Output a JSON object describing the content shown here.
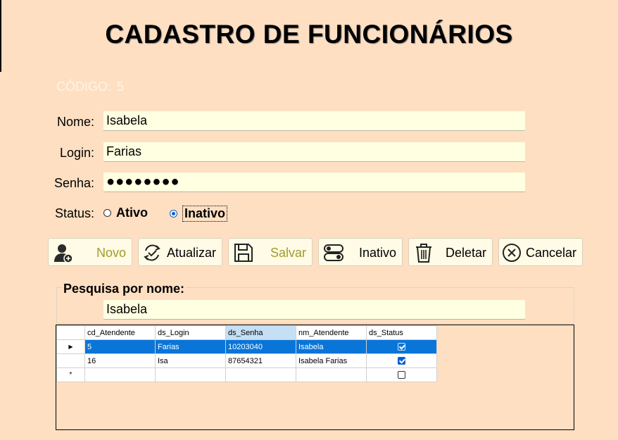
{
  "form": {
    "title": "CADASTRO DE FUNCIONÁRIOS",
    "codigo_label": "CÓDIGO:",
    "codigo_value": "5",
    "nome_label": "Nome:",
    "nome_value": "Isabela",
    "login_label": "Login:",
    "login_value": "Farias",
    "senha_label": "Senha:",
    "senha_value": "●●●●●●●●",
    "status_label": "Status:",
    "status_options": [
      "Ativo",
      "Inativo"
    ],
    "status_selected": "Inativo"
  },
  "toolbar": {
    "novo": "Novo",
    "atualizar": "Atualizar",
    "salvar": "Salvar",
    "inativo": "Inativo",
    "deletar": "Deletar",
    "cancelar": "Cancelar"
  },
  "search": {
    "label": "Pesquisa por nome:",
    "value": "Isabela"
  },
  "grid": {
    "columns": [
      "cd_Atendente",
      "ds_Login",
      "ds_Senha",
      "nm_Atendente",
      "ds_Status"
    ],
    "rows": [
      {
        "cd": "5",
        "login": "Farias",
        "senha": "10203040",
        "nome": "Isabela",
        "status": true
      },
      {
        "cd": "16",
        "login": "Isa",
        "senha": "87654321",
        "nome": "Isabela Farias",
        "status": true
      }
    ],
    "row_indicator": "▶",
    "new_row_indicator": "*"
  },
  "colors": {
    "background": "#ffdfc2",
    "field": "#ffffe1",
    "selection": "#0a75d8"
  }
}
